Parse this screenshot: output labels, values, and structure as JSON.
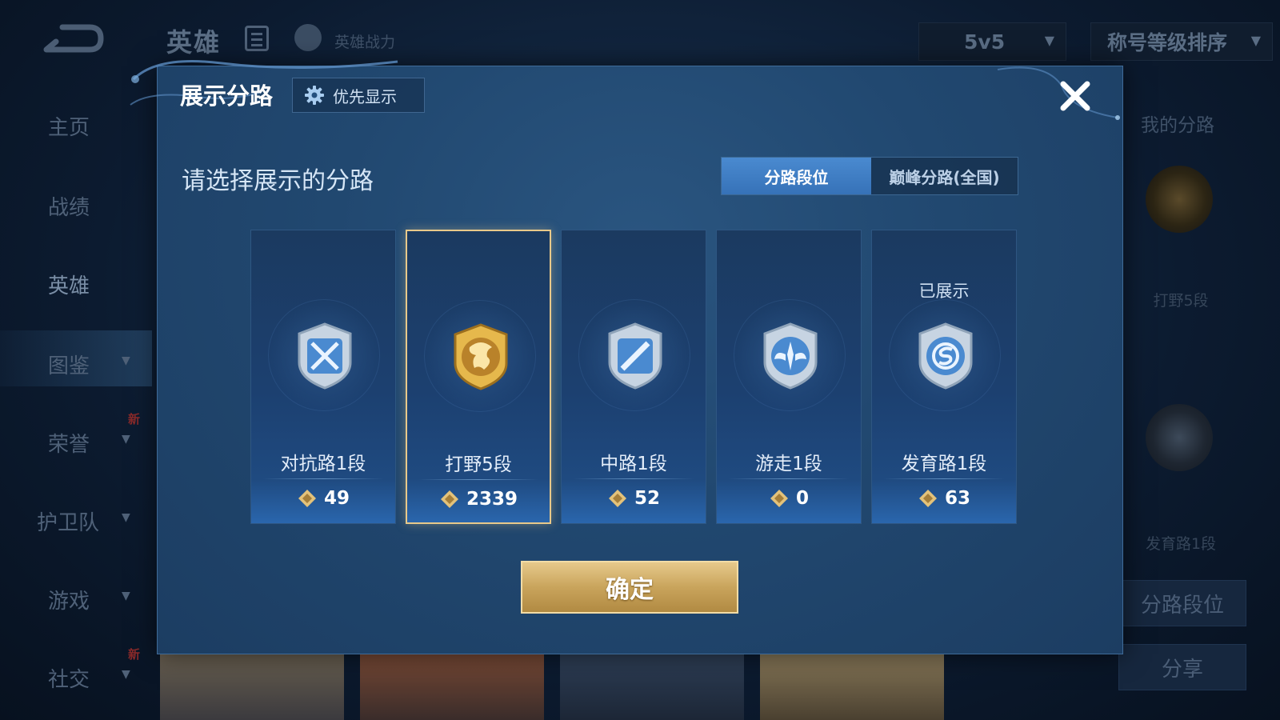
{
  "background": {
    "title": "英雄",
    "power_label": "英雄战力",
    "mode_dropdown": "5v5",
    "sort_dropdown": "称号等级排序",
    "sidebar": [
      {
        "label": "主页",
        "chevron": false,
        "new": false,
        "active": false
      },
      {
        "label": "战绩",
        "chevron": false,
        "new": false,
        "active": false
      },
      {
        "label": "英雄",
        "chevron": false,
        "new": false,
        "active": true
      },
      {
        "label": "图鉴",
        "chevron": true,
        "new": false,
        "active": false
      },
      {
        "label": "荣誉",
        "chevron": true,
        "new": true,
        "active": false
      },
      {
        "label": "护卫队",
        "chevron": true,
        "new": false,
        "active": false
      },
      {
        "label": "游戏",
        "chevron": true,
        "new": false,
        "active": false
      },
      {
        "label": "社交",
        "chevron": true,
        "new": true,
        "active": false
      }
    ],
    "new_badge": "新",
    "right_panel": {
      "title": "我的分路",
      "lane1_label": "打野5段",
      "lane2_label": "发育路1段",
      "lane_rank_button": "分路段位",
      "share_button": "分享"
    }
  },
  "modal": {
    "title": "展示分路",
    "priority_button": "优先显示",
    "subtitle": "请选择展示的分路",
    "tabs": [
      {
        "label": "分路段位",
        "active": true
      },
      {
        "label": "巅峰分路(全国)",
        "active": false
      }
    ],
    "shown_label": "已展示",
    "lanes": [
      {
        "name": "对抗路1段",
        "score": "49",
        "icon": "clash-lane-emblem-icon",
        "selected": false,
        "shown": false
      },
      {
        "name": "打野5段",
        "score": "2339",
        "icon": "jungle-dragon-emblem-icon",
        "selected": true,
        "shown": false
      },
      {
        "name": "中路1段",
        "score": "52",
        "icon": "mid-lane-emblem-icon",
        "selected": false,
        "shown": false
      },
      {
        "name": "游走1段",
        "score": "0",
        "icon": "roam-wings-emblem-icon",
        "selected": false,
        "shown": false
      },
      {
        "name": "发育路1段",
        "score": "63",
        "icon": "farm-lane-emblem-icon",
        "selected": false,
        "shown": true
      }
    ],
    "confirm_button": "确定"
  },
  "colors": {
    "accent_gold": "#e8c98a",
    "tab_active": "#3f7ec4",
    "modal_bg": "#214870"
  }
}
